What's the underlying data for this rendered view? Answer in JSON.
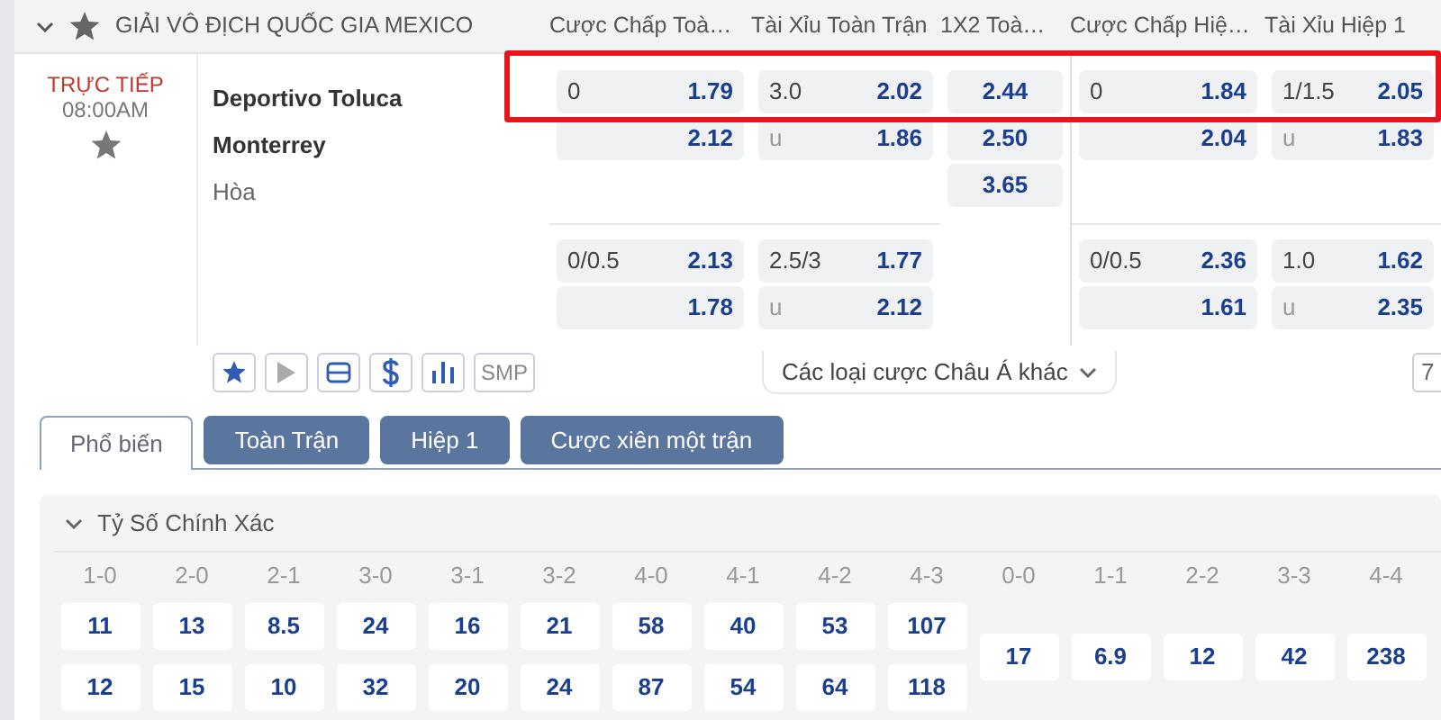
{
  "league": {
    "title": "GIẢI VÔ ĐỊCH QUỐC GIA MEXICO",
    "expanded": true
  },
  "match": {
    "status": "TRỰC TIẾP",
    "time": "08:00AM",
    "favorite": false,
    "teams": [
      {
        "name": "Deportivo Toluca",
        "kind": "team"
      },
      {
        "name": "Monterrey",
        "kind": "team"
      },
      {
        "name": "Hòa",
        "kind": "draw"
      }
    ],
    "market_groups": [
      {
        "markets": [
          {
            "header": "Cược Chấp Toà…",
            "kind": "pair",
            "lines": [
              [
                {
                  "label": "0",
                  "odds": "1.79"
                },
                {
                  "odds": "2.12"
                }
              ],
              [
                {
                  "label": "0/0.5",
                  "odds": "2.13"
                },
                {
                  "odds": "1.78"
                }
              ]
            ]
          },
          {
            "header": "Tài Xỉu Toàn Trận",
            "kind": "pair",
            "lines": [
              [
                {
                  "label": "3.0",
                  "odds": "2.02"
                },
                {
                  "label": "u",
                  "odds": "1.86"
                }
              ],
              [
                {
                  "label": "2.5/3",
                  "odds": "1.77"
                },
                {
                  "label": "u",
                  "odds": "2.12"
                }
              ]
            ]
          },
          {
            "header": "1X2 Toà…",
            "kind": "single",
            "lines": [
              [
                {
                  "odds": "2.44"
                },
                {
                  "odds": "2.50"
                },
                {
                  "odds": "3.65"
                }
              ]
            ]
          }
        ]
      },
      {
        "markets": [
          {
            "header": "Cược Chấp Hiệ…",
            "kind": "pair",
            "lines": [
              [
                {
                  "label": "0",
                  "odds": "1.84"
                },
                {
                  "odds": "2.04"
                }
              ],
              [
                {
                  "label": "0/0.5",
                  "odds": "2.36"
                },
                {
                  "odds": "1.61"
                }
              ]
            ]
          },
          {
            "header": "Tài Xỉu Hiệp 1",
            "kind": "pair",
            "lines": [
              [
                {
                  "label": "1/1.5",
                  "odds": "2.05"
                },
                {
                  "label": "u",
                  "odds": "1.83"
                }
              ],
              [
                {
                  "label": "1.0",
                  "odds": "1.62"
                },
                {
                  "label": "u",
                  "odds": "2.35"
                }
              ]
            ]
          }
        ]
      }
    ],
    "toolbar": [
      {
        "kind": "star",
        "active": true
      },
      {
        "kind": "play",
        "active": false
      },
      {
        "kind": "ticket",
        "active": true
      },
      {
        "kind": "dollar",
        "active": true
      },
      {
        "kind": "stats",
        "active": true
      },
      {
        "kind": "text",
        "label": "SMP",
        "active": false
      }
    ],
    "more_link": "Các loại cược Châu Á khác",
    "count_box": "7"
  },
  "highlight_frame": true,
  "tabs": [
    {
      "label": "Phổ biến",
      "selected": true
    },
    {
      "label": "Toàn Trận",
      "selected": false
    },
    {
      "label": "Hiệp 1",
      "selected": false
    },
    {
      "label": "Cược xiên một trận",
      "selected": false
    }
  ],
  "section": {
    "title": "Tỷ Số Chính Xác",
    "expanded": true,
    "scores": [
      {
        "label": "1-0",
        "odds": [
          "11",
          "12"
        ]
      },
      {
        "label": "2-0",
        "odds": [
          "13",
          "15"
        ]
      },
      {
        "label": "2-1",
        "odds": [
          "8.5",
          "10"
        ]
      },
      {
        "label": "3-0",
        "odds": [
          "24",
          "32"
        ]
      },
      {
        "label": "3-1",
        "odds": [
          "16",
          "20"
        ]
      },
      {
        "label": "3-2",
        "odds": [
          "21",
          "24"
        ]
      },
      {
        "label": "4-0",
        "odds": [
          "58",
          "87"
        ]
      },
      {
        "label": "4-1",
        "odds": [
          "40",
          "54"
        ]
      },
      {
        "label": "4-2",
        "odds": [
          "53",
          "64"
        ]
      },
      {
        "label": "4-3",
        "odds": [
          "107",
          "118"
        ]
      },
      {
        "label": "0-0",
        "odds": [
          "17"
        ]
      },
      {
        "label": "1-1",
        "odds": [
          "6.9"
        ]
      },
      {
        "label": "2-2",
        "odds": [
          "12"
        ]
      },
      {
        "label": "3-3",
        "odds": [
          "42"
        ]
      },
      {
        "label": "4-4",
        "odds": [
          "238"
        ]
      }
    ]
  }
}
